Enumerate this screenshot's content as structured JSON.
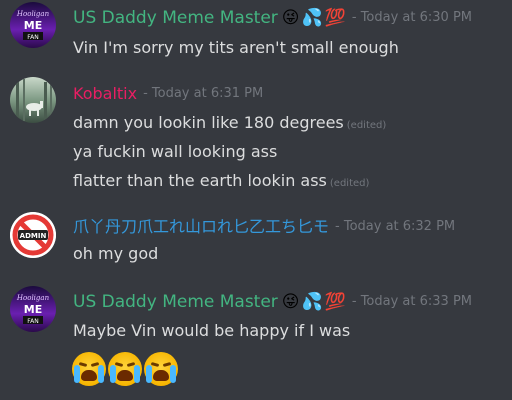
{
  "messages": [
    {
      "author": "US Daddy Meme Master",
      "author_color": "#43b581",
      "emojis": [
        "😜",
        "💦",
        "💯"
      ],
      "timestamp": "- Today at 6:30 PM",
      "lines": [
        {
          "text": "Vin I'm sorry my tits aren't small enough",
          "edited": ""
        }
      ]
    },
    {
      "author": "Kobaltix",
      "author_color": "#e91e63",
      "emojis": [],
      "timestamp": "- Today at 6:31 PM",
      "lines": [
        {
          "text": "damn you lookin like 180 degrees",
          "edited": "(edited)"
        },
        {
          "text": "ya fuckin wall looking ass",
          "edited": ""
        },
        {
          "text": "flatter than the earth lookin ass",
          "edited": "(edited)"
        }
      ]
    },
    {
      "author": "爪丫丹刀爪工れ山ロれ匕乙工ち匕モ",
      "author_color": "#3498db",
      "emojis": [],
      "timestamp": "- Today at 6:32 PM",
      "avatar_text": "ADMIN",
      "lines": [
        {
          "text": "oh my god",
          "edited": ""
        }
      ]
    },
    {
      "author": "US Daddy Meme Master",
      "author_color": "#43b581",
      "emojis": [
        "😜",
        "💦",
        "💯"
      ],
      "timestamp": "- Today at 6:33 PM",
      "lines": [
        {
          "text": "Maybe Vin would be happy if I was",
          "edited": ""
        }
      ],
      "big_emojis": [
        "loudly-crying-face",
        "loudly-crying-face",
        "loudly-crying-face"
      ]
    }
  ]
}
